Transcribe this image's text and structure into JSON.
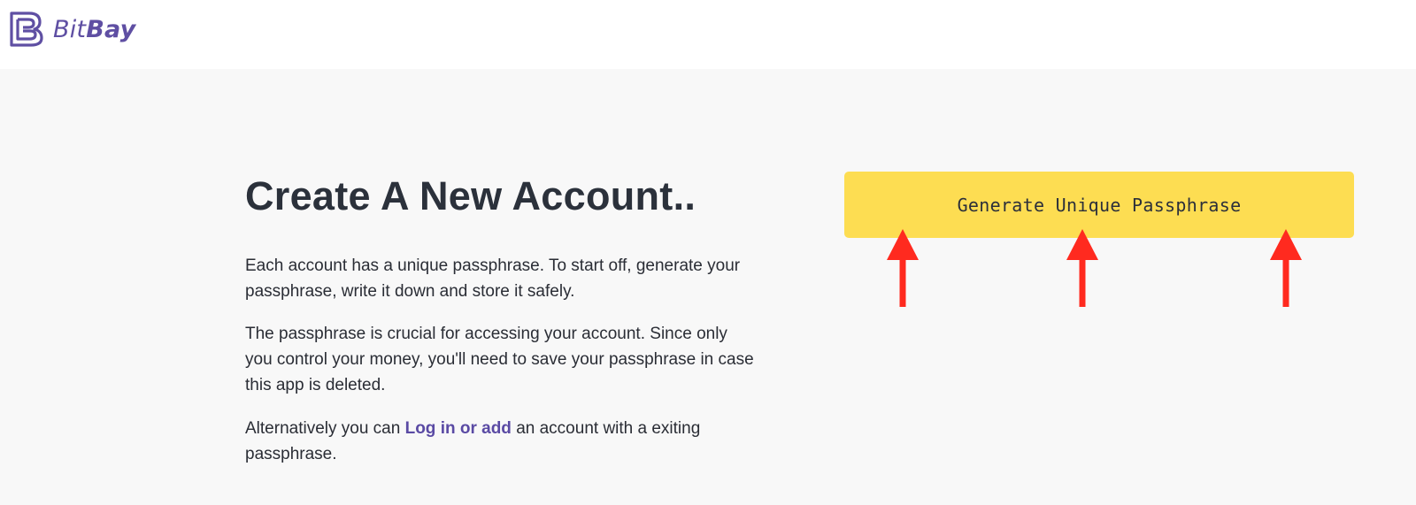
{
  "header": {
    "logo_text_light": "Bit",
    "logo_text_bold": "Bay",
    "brand_color": "#5f4fa3"
  },
  "main": {
    "title": "Create A New Account..",
    "paragraph1": "Each account has a unique passphrase. To start off, generate your passphrase, write it down and store it safely.",
    "paragraph2": "The passphrase is crucial for accessing your account. Since only you control your money, you'll need to save your passphrase in case this app is deleted.",
    "paragraph3_before": "Alternatively you can ",
    "paragraph3_link": "Log in or add",
    "paragraph3_after": " an account with a exiting passphrase.",
    "generate_button_label": "Generate Unique Passphrase",
    "button_color": "#fddd52",
    "link_color": "#5a4aa4"
  },
  "annotations": {
    "arrow_color": "#ff2a1f",
    "arrow_icon": "up-arrow-icon",
    "arrow_count": 3
  }
}
